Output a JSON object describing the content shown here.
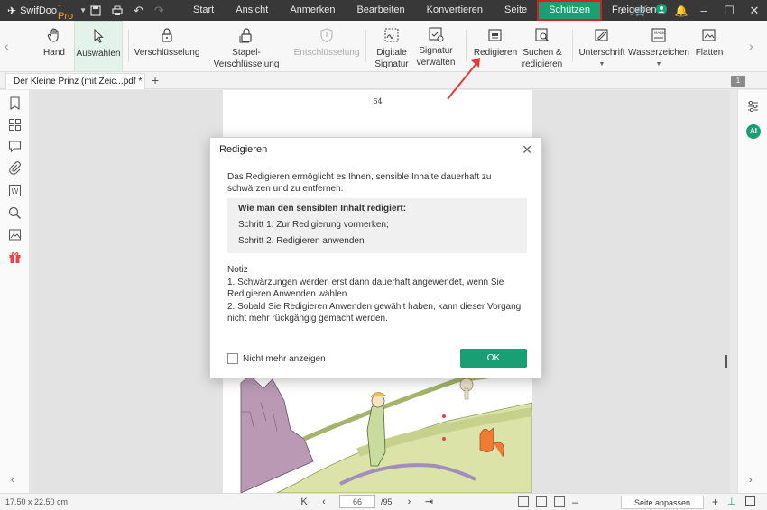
{
  "app": {
    "name": "SwifDoo",
    "edition": "-Pro"
  },
  "menu": {
    "items": [
      {
        "label": "Start"
      },
      {
        "label": "Ansicht"
      },
      {
        "label": "Anmerken"
      },
      {
        "label": "Bearbeiten"
      },
      {
        "label": "Konvertieren"
      },
      {
        "label": "Seite"
      },
      {
        "label": "Schützen"
      },
      {
        "label": "Freigeben"
      }
    ],
    "active": "Schützen"
  },
  "ribbon": {
    "hand": "Hand",
    "auswaehlen": "Auswählen",
    "verschluesselung": "Verschlüsselung",
    "stapel": "Stapel-Verschlüsselung",
    "entschluesselung": "Entschlüsselung",
    "digitale_1": "Digitale",
    "digitale_2": "Signatur",
    "signatur_1": "Signatur",
    "signatur_2": "verwalten",
    "redigieren": "Redigieren",
    "suchen_1": "Suchen &",
    "suchen_2": "redigieren",
    "unterschrift": "Unterschrift",
    "wasserzeichen": "Wasserzeichen",
    "flatten": "Flatten"
  },
  "tab": {
    "title": "Der Kleine Prinz (mit Zeic...pdf *",
    "page_badge": "1"
  },
  "document": {
    "page_number": "64"
  },
  "dialog": {
    "title": "Redigieren",
    "description": "Das Redigieren ermöglicht es Ihnen, sensible Inhalte dauerhaft zu schwärzen und zu entfernen.",
    "howto_heading": "Wie man den sensiblen Inhalt redigiert:",
    "step1": "Schritt 1. Zur Redigierung vormerken;",
    "step2": "Schritt 2. Redigieren anwenden",
    "note_heading": "Notiz",
    "note1": "1. Schwärzungen werden erst dann dauerhaft angewendet, wenn Sie Redigieren Anwenden wählen.",
    "note2": "2. Sobald Sie Redigieren Anwenden gewählt haben, kann dieser Vorgang nicht mehr rückgängig gemacht werden.",
    "checkbox_label": "Nicht mehr anzeigen",
    "ok_label": "OK"
  },
  "status": {
    "dimensions": "17.50 x 22.50 cm",
    "current_page": "66",
    "total_pages": "/95",
    "zoom_mode": "Seite anpassen"
  },
  "colors": {
    "accent": "#1a9e73",
    "titlebar": "#383838",
    "highlight": "#d42020"
  }
}
